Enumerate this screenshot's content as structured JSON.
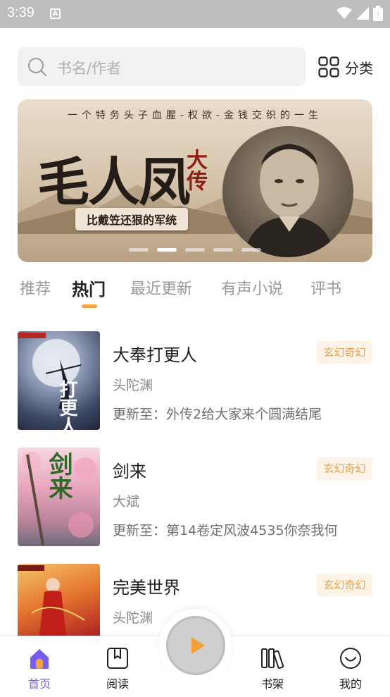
{
  "status_bar": {
    "time": "3:39",
    "notification_letter": "A"
  },
  "search": {
    "placeholder": "书名/作者"
  },
  "category": {
    "label": "分类"
  },
  "banner": {
    "tagline": "一个特务头子血腥-权欲-金钱交织的一生",
    "title": "毛人凤",
    "subtitle": "大传",
    "slogan": "比戴笠还狠的军统",
    "slide_count": 5,
    "active_slide": 1
  },
  "tabs": [
    {
      "label": "推荐",
      "active": false
    },
    {
      "label": "热门",
      "active": true
    },
    {
      "label": "最近更新",
      "active": false
    },
    {
      "label": "有声小说",
      "active": false
    },
    {
      "label": "评书",
      "active": false
    }
  ],
  "books": [
    {
      "title": "大奉打更人",
      "author": "头陀渊",
      "update": "更新至：外传2给大家来个圆满结尾",
      "tag": "玄幻奇幻",
      "cover_text": "打更人"
    },
    {
      "title": "剑来",
      "author": "大斌",
      "update": "更新至：第14卷定风波4535你奈我何",
      "tag": "玄幻奇幻",
      "cover_text": "剑来"
    },
    {
      "title": "完美世界",
      "author": "头陀渊",
      "update": "",
      "tag": "玄幻奇幻",
      "cover_text": ""
    }
  ],
  "bottom_nav": {
    "home": "首页",
    "read": "阅读",
    "shelf": "书架",
    "mine": "我的"
  },
  "colors": {
    "accent": "#f5a33c",
    "nav_active": "#7b5cf0",
    "tag_bg": "#fdf3e6",
    "tag_text": "#e3a350"
  }
}
